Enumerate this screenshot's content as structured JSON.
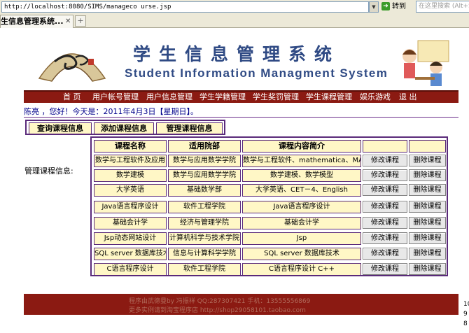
{
  "browser": {
    "url": "http://localhost:8080/SIMS/manageco urse.jsp",
    "go_label": "转到",
    "search_placeholder": "在这里搜索 (Alt+S)",
    "tab_title": "生信息管理系统...",
    "new_tab": "+"
  },
  "header": {
    "title_zh": "学生信息管理系统",
    "title_en": "Student Information Managment System"
  },
  "nav": {
    "items": [
      "首 页",
      "用户帐号管理",
      "用户信息管理",
      "学生学籍管理",
      "学生奖罚管理",
      "学生课程管理",
      "娱乐游戏",
      "退 出"
    ]
  },
  "welcome": "陈亮 ，您好！今天是：2011年4月3日【星期日】。",
  "submenu": {
    "query": "查询课程信息",
    "add": "添加课程信息",
    "manage": "管理课程信息"
  },
  "side_label": "管理课程信息:",
  "table": {
    "headers": [
      "课程名称",
      "适用院部",
      "课程内容简介",
      "",
      ""
    ],
    "rows": [
      [
        "数学与工程软件及应用",
        "数学与应用数学学院",
        "数学与工程软件、mathematica、MATLAB"
      ],
      [
        "数学建模",
        "数学与应用数学学院",
        "数学建模、数学模型"
      ],
      [
        "大学英语",
        "基础数学部",
        "大学英语、CET－4、English"
      ],
      [
        "Java语言程序设计",
        "软件工程学院",
        "Java语言程序设计"
      ],
      [
        "基础会计学",
        "经济与管理学院",
        "基础会计学"
      ],
      [
        "Jsp动态网站设计",
        "计算机科学与技术学院",
        "Jsp"
      ],
      [
        "SQL server 数据库技术",
        "信息与计算科学学院",
        "SQL server 数据库技术"
      ],
      [
        "C语言程序设计",
        "软件工程学院",
        "C语言程序设计 C++"
      ]
    ],
    "edit_label": "修改课程",
    "delete_label": "删除课程"
  },
  "footer": {
    "line1": "程序由武德曼by 冯振祥    QQ:287307421    手机：13555556869",
    "line2": "更多实例请到淘宝程序店 http://shop29058101.taobao.com"
  },
  "scroll_numbers": [
    "10",
    "9",
    "8"
  ],
  "colors": {
    "nav_bg": "#8b1a12",
    "cell_bg": "#fff7c6",
    "border": "#5a2a7a",
    "title_blue": "#2f4a84"
  }
}
